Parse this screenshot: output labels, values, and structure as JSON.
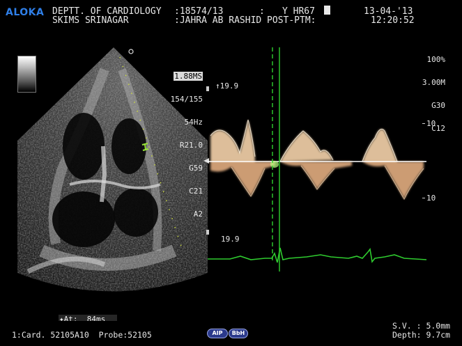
{
  "header": {
    "brand": "ALOKA",
    "line1_left": "DEPTT. OF CARDIOLOGY",
    "line1_id": ":18574/13",
    "line1_colon": ":",
    "line1_code": "Y HR67",
    "date": "13-04-'13",
    "line2_left": "SKIMS SRINAGAR",
    "line2_patient": ":JAHRA AB RASHID POST-PTM:",
    "time": "12:20:52"
  },
  "bmode_params": {
    "highlight": "1.88MS",
    "values": [
      "154/155",
      "54Hz",
      "R21.0",
      "G59",
      "C21",
      "A2"
    ]
  },
  "doppler_params": {
    "values": [
      "100%",
      "3.00M",
      "G30",
      "C12"
    ]
  },
  "doppler_scale": {
    "top_velocity": "↑19.9",
    "bottom_velocity": "19.9",
    "upper_tick": "10",
    "lower_tick": "10"
  },
  "measurement": {
    "label": "✦At:  84ms"
  },
  "footer": {
    "left": "1:Card. 52105A10  Probe:52105",
    "pill1": "AIP",
    "pill2": "BbH",
    "sv": "S.V. : 5.0mm",
    "depth": "Depth: 9.7cm"
  },
  "colors": {
    "brand": "#2f7fe8",
    "cursor": "#2fd12f",
    "ecg": "#2fcc2f",
    "doppler_signal": "#f2d8b8",
    "sample_volume": "#9be63a"
  }
}
